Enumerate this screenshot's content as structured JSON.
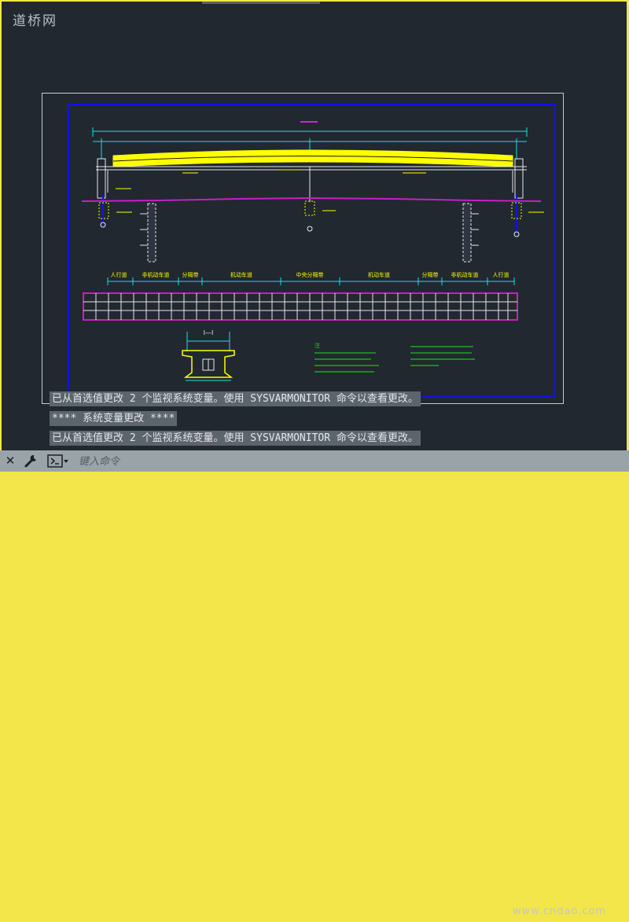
{
  "window": {
    "watermark_text": "道桥网",
    "site_mark": "www.cndao.com",
    "colors": {
      "border": "#f2e64a",
      "model_space": "#212830",
      "frame": "#0f14e8",
      "girder": "#ffff00",
      "ground_line": "#c71fc7",
      "dimension": "#19e0e0",
      "notes": "#19e619",
      "command_bar": "#9aa3a8"
    }
  },
  "drawing": {
    "notes_heading": "注",
    "section_label": "I—I",
    "span_labels": [
      "人行道",
      "非机动车道",
      "分隔带",
      "机动车道",
      "中央分隔带",
      "机动车道",
      "分隔带",
      "非机动车道",
      "人行道"
    ]
  },
  "command_history": [
    "已从首选值更改 2 个监视系统变量。使用 SYSVARMONITOR 命令以查看更改。",
    "**** 系统变量更改 ****",
    "已从首选值更改 2 个监视系统变量。使用 SYSVARMONITOR 命令以查看更改。"
  ],
  "command_bar": {
    "close_icon": "close-icon",
    "customize_icon": "wrench-icon",
    "prompt_icon": "command-prompt-icon",
    "input_placeholder": "键入命令"
  }
}
